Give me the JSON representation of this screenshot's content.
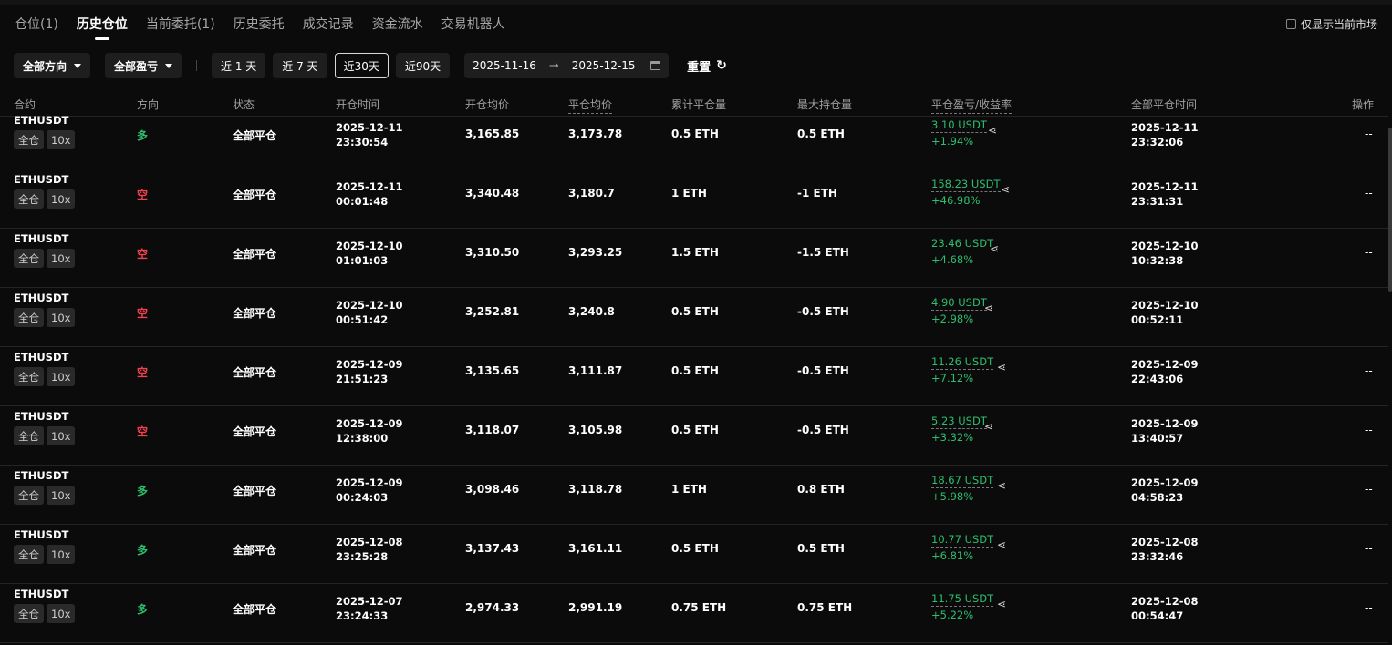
{
  "tabs": [
    {
      "label": "仓位(1)"
    },
    {
      "label": "历史仓位"
    },
    {
      "label": "当前委托(1)"
    },
    {
      "label": "历史委托"
    },
    {
      "label": "成交记录"
    },
    {
      "label": "资金流水"
    },
    {
      "label": "交易机器人"
    }
  ],
  "only_current_label": "仅显示当前市场",
  "filters": {
    "direction": "全部方向",
    "pnl": "全部盈亏",
    "range_1d": "近 1 天",
    "range_7d": "近 7 天",
    "range_30d": "近30天",
    "range_90d": "近90天",
    "date_from": "2025-11-16",
    "date_to": "2025-12-15",
    "reset": "重置"
  },
  "columns": {
    "contract": "合约",
    "direction": "方向",
    "status": "状态",
    "open_time": "开仓时间",
    "avg_open": "开仓均价",
    "avg_close": "平仓均价",
    "cum_close": "累计平仓量",
    "max_hold": "最大持仓量",
    "pnl": "平仓盈亏/收益率",
    "close_time": "全部平仓时间",
    "action": "操作"
  },
  "rows": [
    {
      "symbol": "ETHUSDT",
      "margin": "全仓",
      "lev": "10x",
      "dir": "多",
      "status": "全部平仓",
      "open_date": "2025-12-11",
      "open_clock": "23:30:54",
      "avg_open": "3,165.85",
      "avg_close": "3,173.78",
      "cum": "0.5 ETH",
      "max": "0.5 ETH",
      "pnl": "3.10 USDT",
      "roi": "+1.94%",
      "close_date": "2025-12-11",
      "close_clock": "23:32:06",
      "op": "--"
    },
    {
      "symbol": "ETHUSDT",
      "margin": "全仓",
      "lev": "10x",
      "dir": "空",
      "status": "全部平仓",
      "open_date": "2025-12-11",
      "open_clock": "00:01:48",
      "avg_open": "3,340.48",
      "avg_close": "3,180.7",
      "cum": "1 ETH",
      "max": "-1 ETH",
      "pnl": "158.23 USDT",
      "roi": "+46.98%",
      "close_date": "2025-12-11",
      "close_clock": "23:31:31",
      "op": "--"
    },
    {
      "symbol": "ETHUSDT",
      "margin": "全仓",
      "lev": "10x",
      "dir": "空",
      "status": "全部平仓",
      "open_date": "2025-12-10",
      "open_clock": "01:01:03",
      "avg_open": "3,310.50",
      "avg_close": "3,293.25",
      "cum": "1.5 ETH",
      "max": "-1.5 ETH",
      "pnl": "23.46 USDT",
      "roi": "+4.68%",
      "close_date": "2025-12-10",
      "close_clock": "10:32:38",
      "op": "--"
    },
    {
      "symbol": "ETHUSDT",
      "margin": "全仓",
      "lev": "10x",
      "dir": "空",
      "status": "全部平仓",
      "open_date": "2025-12-10",
      "open_clock": "00:51:42",
      "avg_open": "3,252.81",
      "avg_close": "3,240.8",
      "cum": "0.5 ETH",
      "max": "-0.5 ETH",
      "pnl": "4.90 USDT",
      "roi": "+2.98%",
      "close_date": "2025-12-10",
      "close_clock": "00:52:11",
      "op": "--"
    },
    {
      "symbol": "ETHUSDT",
      "margin": "全仓",
      "lev": "10x",
      "dir": "空",
      "status": "全部平仓",
      "open_date": "2025-12-09",
      "open_clock": "21:51:23",
      "avg_open": "3,135.65",
      "avg_close": "3,111.87",
      "cum": "0.5 ETH",
      "max": "-0.5 ETH",
      "pnl": "11.26 USDT",
      "roi": "+7.12%",
      "close_date": "2025-12-09",
      "close_clock": "22:43:06",
      "op": "--"
    },
    {
      "symbol": "ETHUSDT",
      "margin": "全仓",
      "lev": "10x",
      "dir": "空",
      "status": "全部平仓",
      "open_date": "2025-12-09",
      "open_clock": "12:38:00",
      "avg_open": "3,118.07",
      "avg_close": "3,105.98",
      "cum": "0.5 ETH",
      "max": "-0.5 ETH",
      "pnl": "5.23 USDT",
      "roi": "+3.32%",
      "close_date": "2025-12-09",
      "close_clock": "13:40:57",
      "op": "--"
    },
    {
      "symbol": "ETHUSDT",
      "margin": "全仓",
      "lev": "10x",
      "dir": "多",
      "status": "全部平仓",
      "open_date": "2025-12-09",
      "open_clock": "00:24:03",
      "avg_open": "3,098.46",
      "avg_close": "3,118.78",
      "cum": "1 ETH",
      "max": "0.8 ETH",
      "pnl": "18.67 USDT",
      "roi": "+5.98%",
      "close_date": "2025-12-09",
      "close_clock": "04:58:23",
      "op": "--"
    },
    {
      "symbol": "ETHUSDT",
      "margin": "全仓",
      "lev": "10x",
      "dir": "多",
      "status": "全部平仓",
      "open_date": "2025-12-08",
      "open_clock": "23:25:28",
      "avg_open": "3,137.43",
      "avg_close": "3,161.11",
      "cum": "0.5 ETH",
      "max": "0.5 ETH",
      "pnl": "10.77 USDT",
      "roi": "+6.81%",
      "close_date": "2025-12-08",
      "close_clock": "23:32:46",
      "op": "--"
    },
    {
      "symbol": "ETHUSDT",
      "margin": "全仓",
      "lev": "10x",
      "dir": "多",
      "status": "全部平仓",
      "open_date": "2025-12-07",
      "open_clock": "23:24:33",
      "avg_open": "2,974.33",
      "avg_close": "2,991.19",
      "cum": "0.75 ETH",
      "max": "0.75 ETH",
      "pnl": "11.75 USDT",
      "roi": "+5.22%",
      "close_date": "2025-12-08",
      "close_clock": "00:54:47",
      "op": "--"
    }
  ],
  "colors": {
    "long": "#2ebd6e",
    "short": "#f0424f",
    "profit": "#2ebd6e"
  },
  "icons": {
    "share": "share-icon",
    "refresh": "refresh-icon",
    "calendar": "calendar-icon",
    "caret": "caret-down-icon"
  }
}
